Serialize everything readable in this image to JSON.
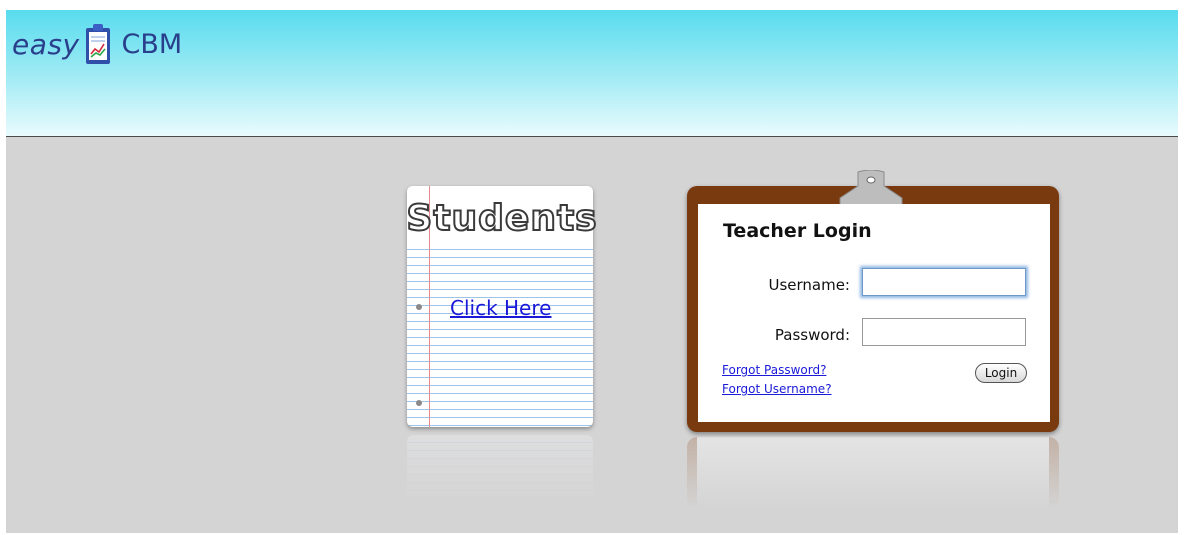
{
  "header": {
    "logo_left": "easy",
    "logo_right": "CBM",
    "logo_icon": "clipboard-chart-icon"
  },
  "students": {
    "title": "Students",
    "link_label": "Click Here"
  },
  "teacher_login": {
    "title": "Teacher Login",
    "username_label": "Username:",
    "username_value": "",
    "password_label": "Password:",
    "password_value": "",
    "forgot_password": "Forgot Password?",
    "forgot_username": "Forgot Username?",
    "login_button": "Login"
  },
  "colors": {
    "header_top": "#58dcee",
    "header_bottom": "#e9fbfd",
    "page_background": "#d4d4d4",
    "clipboard_board": "#7a3a10",
    "link": "#1a1ad8",
    "logo_text": "#2a3f8c"
  }
}
